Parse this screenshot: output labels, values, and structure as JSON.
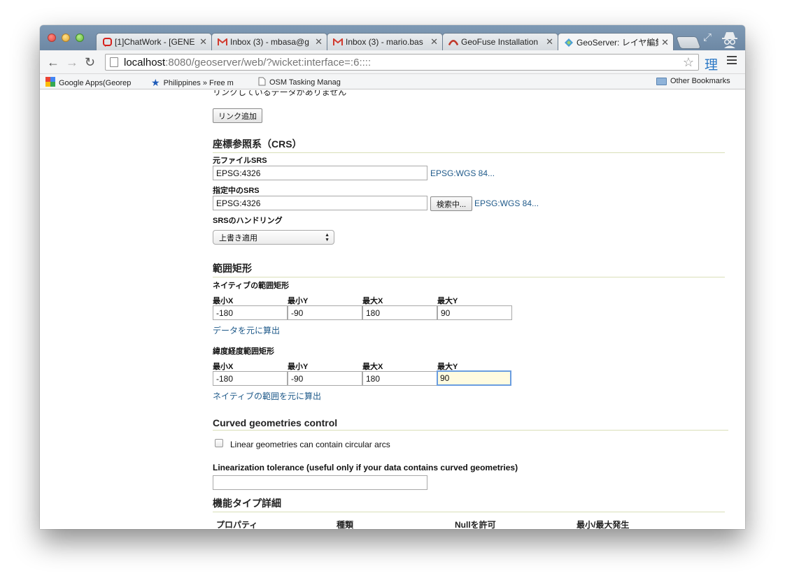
{
  "browser": {
    "tabs": [
      {
        "title": "[1]ChatWork - [GENE",
        "favicon": "chatwork-icon",
        "active": false
      },
      {
        "title": "Inbox (3) - mbasa@g",
        "favicon": "gmail-icon",
        "active": false
      },
      {
        "title": "Inbox (3) - mario.bas",
        "favicon": "gmail-icon",
        "active": false
      },
      {
        "title": "GeoFuse Installation",
        "favicon": "geofuse-icon",
        "active": false
      },
      {
        "title": "GeoServer: レイヤ編集",
        "favicon": "geoserver-icon",
        "active": true
      }
    ],
    "url_host": "localhost",
    "url_rest": ":8080/geoserver/web/?wicket:interface=:6::::",
    "extension_label": "理",
    "bookmarks": [
      {
        "label": "Google Apps(Georep",
        "icon": "google-apps-icon"
      },
      {
        "label": "Philippines » Free m",
        "icon": "star-icon"
      },
      {
        "label": "OSM Tasking Manag",
        "icon": "page-icon"
      }
    ],
    "other_bookmarks": "Other Bookmarks"
  },
  "form": {
    "cut_text": "リンクしているデータがありません",
    "add_link_button": "リンク追加",
    "crs": {
      "title": "座標参照系（CRS）",
      "native_srs_label": "元ファイルSRS",
      "native_srs_value": "EPSG:4326",
      "native_srs_link": "EPSG:WGS 84...",
      "declared_srs_label": "指定中のSRS",
      "declared_srs_value": "EPSG:4326",
      "find_button": "検索中...",
      "declared_srs_link": "EPSG:WGS 84...",
      "srs_handling_label": "SRSのハンドリング",
      "srs_handling_value": "上書き適用"
    },
    "bbox": {
      "title": "範囲矩形",
      "native_label": "ネイティブの範囲矩形",
      "col_labels": [
        "最小X",
        "最小Y",
        "最大X",
        "最大Y"
      ],
      "native_values": [
        "-180",
        "-90",
        "180",
        "90"
      ],
      "compute_from_data": "データを元に算出",
      "latlon_label": "緯度経度範囲矩形",
      "latlon_values": [
        "-180",
        "-90",
        "180",
        "90"
      ],
      "compute_from_native": "ネイティブの範囲を元に算出"
    },
    "curved": {
      "title": "Curved geometries control",
      "checkbox_label": "Linear geometries can contain circular arcs",
      "tolerance_label": "Linearization tolerance (useful only if your data contains curved geometries)",
      "tolerance_value": ""
    },
    "feature_type": {
      "title": "機能タイプ詳細",
      "columns": [
        "プロパティ",
        "種類",
        "Nullを許可",
        "最小/最大発生"
      ]
    }
  }
}
